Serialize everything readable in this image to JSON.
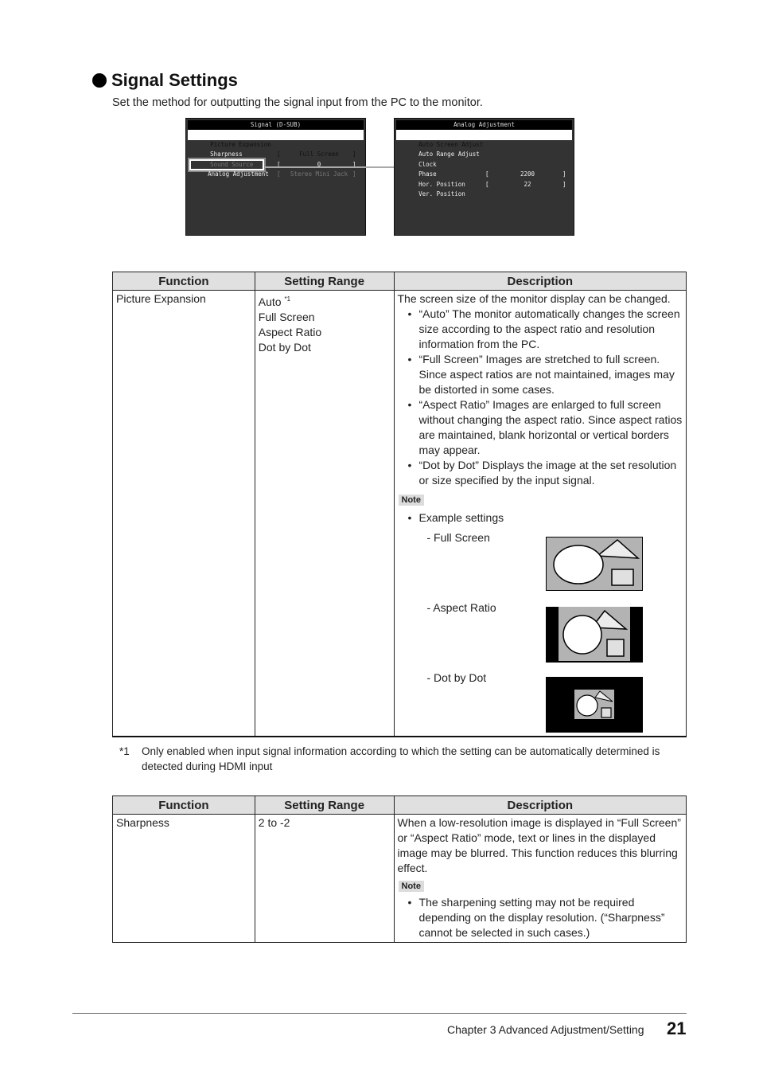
{
  "section": {
    "title": "Signal Settings",
    "intro": "Set the method for outputting the signal input from the PC to the monitor."
  },
  "osd_signal": {
    "title": "Signal (D-SUB)",
    "rows": [
      {
        "label": "Picture Expansion",
        "value": "Full Screen",
        "state": "selected"
      },
      {
        "label": "Sharpness",
        "value": "0",
        "state": "normal"
      },
      {
        "label": "Sound Source",
        "value": "Stereo Mini Jack",
        "state": "disabled"
      },
      {
        "label": "Analog Adjustment",
        "value": "",
        "state": "highlighted"
      }
    ]
  },
  "osd_analog": {
    "title": "Analog Adjustment",
    "rows": [
      {
        "label": "Auto Screen Adjust",
        "value": "",
        "state": "selected"
      },
      {
        "label": "Auto Range Adjust",
        "value": ""
      },
      {
        "label": "Clock",
        "value": "2200"
      },
      {
        "label": "Phase",
        "value": "22"
      },
      {
        "label": "Hor. Position",
        "value": ""
      },
      {
        "label": "Ver. Position",
        "value": ""
      }
    ]
  },
  "table_headers": [
    "Function",
    "Setting Range",
    "Description"
  ],
  "table1": {
    "function": "Picture Expansion",
    "ranges": [
      "Auto",
      "Full Screen",
      "Aspect Ratio",
      "Dot by Dot"
    ],
    "auto_footnote_mark": "*1",
    "description_intro": "The screen size of the monitor display can be changed.",
    "bullets": [
      "“Auto” The monitor automatically changes the screen size according to the aspect ratio and resolution information from the PC.",
      "“Full Screen” Images are stretched to full screen. Since aspect ratios are not maintained, images may be distorted in some cases.",
      "“Aspect Ratio” Images are enlarged to full screen without changing the aspect ratio. Since aspect ratios are maintained, blank horizontal or vertical borders may appear.",
      "“Dot by Dot” Displays the image at the set resolution or size specified by the input signal."
    ],
    "note_label": "Note",
    "note_bullet": "Example settings",
    "examples": [
      "- Full Screen",
      "- Aspect Ratio",
      "- Dot by Dot"
    ]
  },
  "footnote": {
    "mark": "*1",
    "text": "Only enabled when input signal information according to which the setting can be automatically determined is detected during HDMI input"
  },
  "table2": {
    "function": "Sharpness",
    "range": "2 to -2",
    "description": "When a low-resolution image is displayed in “Full Screen” or “Aspect Ratio” mode, text or lines in the displayed image may be blurred. This function reduces this blurring effect.",
    "note_label": "Note",
    "note_bullet": "The sharpening setting may not be required depending on the display resolution. (“Sharpness” cannot be selected in such cases.)"
  },
  "footer": {
    "chapter": "Chapter 3 Advanced Adjustment/Setting",
    "page": "21"
  }
}
